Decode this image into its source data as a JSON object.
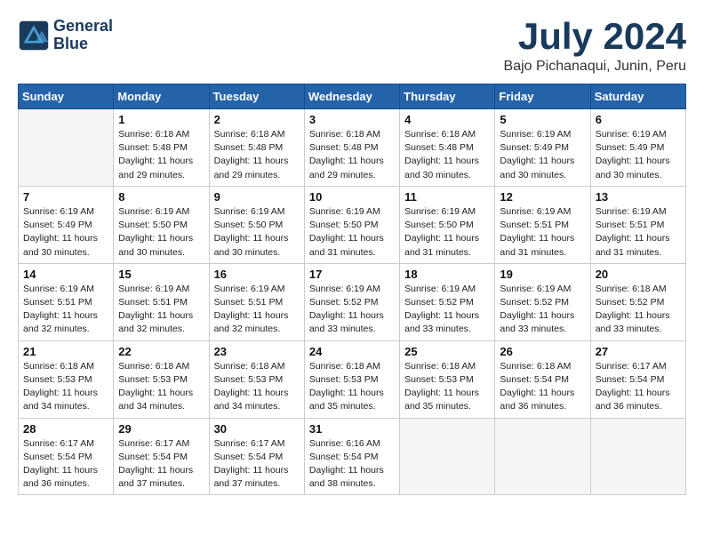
{
  "header": {
    "logo_line1": "General",
    "logo_line2": "Blue",
    "month_title": "July 2024",
    "subtitle": "Bajo Pichanaqui, Junin, Peru"
  },
  "days_of_week": [
    "Sunday",
    "Monday",
    "Tuesday",
    "Wednesday",
    "Thursday",
    "Friday",
    "Saturday"
  ],
  "weeks": [
    [
      {
        "day": "",
        "info": ""
      },
      {
        "day": "1",
        "info": "Sunrise: 6:18 AM\nSunset: 5:48 PM\nDaylight: 11 hours\nand 29 minutes."
      },
      {
        "day": "2",
        "info": "Sunrise: 6:18 AM\nSunset: 5:48 PM\nDaylight: 11 hours\nand 29 minutes."
      },
      {
        "day": "3",
        "info": "Sunrise: 6:18 AM\nSunset: 5:48 PM\nDaylight: 11 hours\nand 29 minutes."
      },
      {
        "day": "4",
        "info": "Sunrise: 6:18 AM\nSunset: 5:48 PM\nDaylight: 11 hours\nand 30 minutes."
      },
      {
        "day": "5",
        "info": "Sunrise: 6:19 AM\nSunset: 5:49 PM\nDaylight: 11 hours\nand 30 minutes."
      },
      {
        "day": "6",
        "info": "Sunrise: 6:19 AM\nSunset: 5:49 PM\nDaylight: 11 hours\nand 30 minutes."
      }
    ],
    [
      {
        "day": "7",
        "info": ""
      },
      {
        "day": "8",
        "info": "Sunrise: 6:19 AM\nSunset: 5:50 PM\nDaylight: 11 hours\nand 30 minutes."
      },
      {
        "day": "9",
        "info": "Sunrise: 6:19 AM\nSunset: 5:50 PM\nDaylight: 11 hours\nand 30 minutes."
      },
      {
        "day": "10",
        "info": "Sunrise: 6:19 AM\nSunset: 5:50 PM\nDaylight: 11 hours\nand 31 minutes."
      },
      {
        "day": "11",
        "info": "Sunrise: 6:19 AM\nSunset: 5:50 PM\nDaylight: 11 hours\nand 31 minutes."
      },
      {
        "day": "12",
        "info": "Sunrise: 6:19 AM\nSunset: 5:51 PM\nDaylight: 11 hours\nand 31 minutes."
      },
      {
        "day": "13",
        "info": "Sunrise: 6:19 AM\nSunset: 5:51 PM\nDaylight: 11 hours\nand 31 minutes."
      }
    ],
    [
      {
        "day": "14",
        "info": ""
      },
      {
        "day": "15",
        "info": "Sunrise: 6:19 AM\nSunset: 5:51 PM\nDaylight: 11 hours\nand 32 minutes."
      },
      {
        "day": "16",
        "info": "Sunrise: 6:19 AM\nSunset: 5:51 PM\nDaylight: 11 hours\nand 32 minutes."
      },
      {
        "day": "17",
        "info": "Sunrise: 6:19 AM\nSunset: 5:52 PM\nDaylight: 11 hours\nand 33 minutes."
      },
      {
        "day": "18",
        "info": "Sunrise: 6:19 AM\nSunset: 5:52 PM\nDaylight: 11 hours\nand 33 minutes."
      },
      {
        "day": "19",
        "info": "Sunrise: 6:19 AM\nSunset: 5:52 PM\nDaylight: 11 hours\nand 33 minutes."
      },
      {
        "day": "20",
        "info": "Sunrise: 6:18 AM\nSunset: 5:52 PM\nDaylight: 11 hours\nand 33 minutes."
      }
    ],
    [
      {
        "day": "21",
        "info": ""
      },
      {
        "day": "22",
        "info": "Sunrise: 6:18 AM\nSunset: 5:53 PM\nDaylight: 11 hours\nand 34 minutes."
      },
      {
        "day": "23",
        "info": "Sunrise: 6:18 AM\nSunset: 5:53 PM\nDaylight: 11 hours\nand 34 minutes."
      },
      {
        "day": "24",
        "info": "Sunrise: 6:18 AM\nSunset: 5:53 PM\nDaylight: 11 hours\nand 35 minutes."
      },
      {
        "day": "25",
        "info": "Sunrise: 6:18 AM\nSunset: 5:53 PM\nDaylight: 11 hours\nand 35 minutes."
      },
      {
        "day": "26",
        "info": "Sunrise: 6:18 AM\nSunset: 5:54 PM\nDaylight: 11 hours\nand 36 minutes."
      },
      {
        "day": "27",
        "info": "Sunrise: 6:17 AM\nSunset: 5:54 PM\nDaylight: 11 hours\nand 36 minutes."
      }
    ],
    [
      {
        "day": "28",
        "info": "Sunrise: 6:17 AM\nSunset: 5:54 PM\nDaylight: 11 hours\nand 36 minutes."
      },
      {
        "day": "29",
        "info": "Sunrise: 6:17 AM\nSunset: 5:54 PM\nDaylight: 11 hours\nand 37 minutes."
      },
      {
        "day": "30",
        "info": "Sunrise: 6:17 AM\nSunset: 5:54 PM\nDaylight: 11 hours\nand 37 minutes."
      },
      {
        "day": "31",
        "info": "Sunrise: 6:16 AM\nSunset: 5:54 PM\nDaylight: 11 hours\nand 38 minutes."
      },
      {
        "day": "",
        "info": ""
      },
      {
        "day": "",
        "info": ""
      },
      {
        "day": "",
        "info": ""
      }
    ]
  ],
  "week7_day7_info": "Sunrise: 6:19 AM\nSunset: 5:49 PM\nDaylight: 11 hours\nand 30 minutes.",
  "week8_day14_info": "Sunrise: 6:19 AM\nSunset: 5:51 PM\nDaylight: 11 hours\nand 32 minutes.",
  "week9_day21_info": "Sunrise: 6:18 AM\nSunset: 5:53 PM\nDaylight: 11 hours\nand 34 minutes."
}
